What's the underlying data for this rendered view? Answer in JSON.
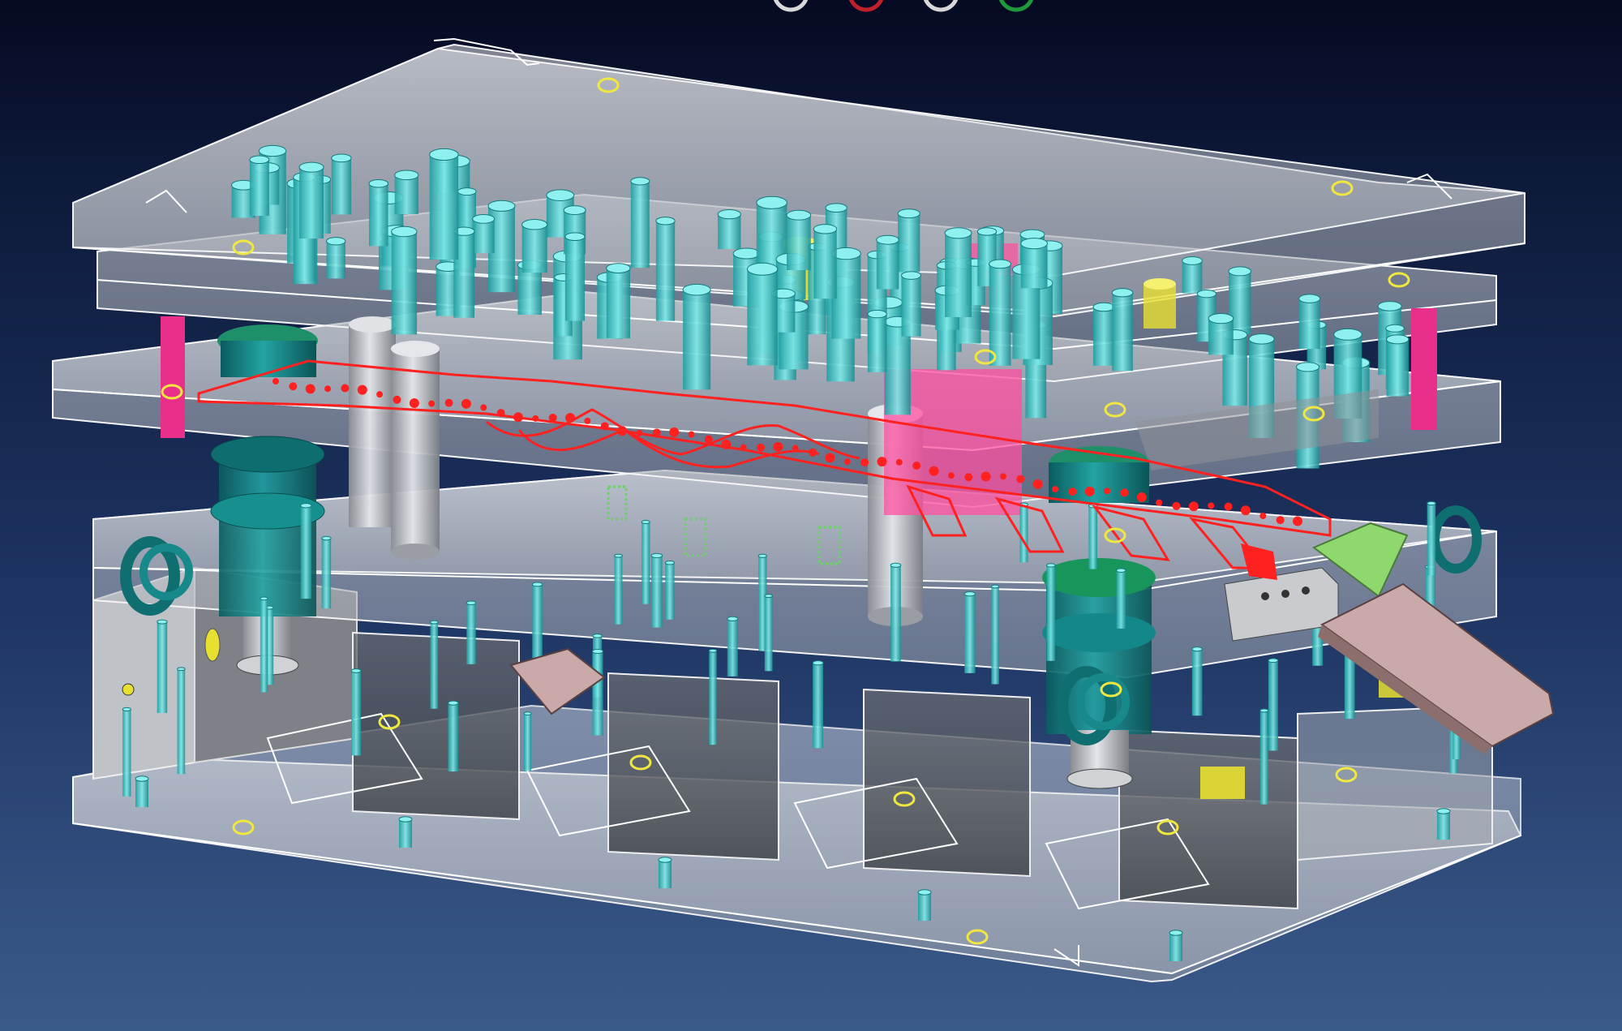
{
  "viewer": {
    "background_top": "#060a22",
    "background_bottom": "#3a5a8a"
  },
  "view_controls": [
    {
      "icon": "white-ring-icon",
      "color": "#d8d8d8"
    },
    {
      "icon": "red-ring-icon",
      "color": "#c0202a"
    },
    {
      "icon": "white-ring-icon",
      "color": "#d8d8d8"
    },
    {
      "icon": "green-ring-icon",
      "color": "#1e9a3c"
    }
  ],
  "model": {
    "plate_color": "#c8ccd2",
    "screw_color": "#3fc6c6",
    "guide_post_color": "#0f7f80",
    "strip_color": "#ff2020",
    "accent_pink": "#ff4fa0",
    "accent_yellow": "#e8e030",
    "accent_green": "#7fd06a",
    "chute_color": "#c9aaa8"
  }
}
